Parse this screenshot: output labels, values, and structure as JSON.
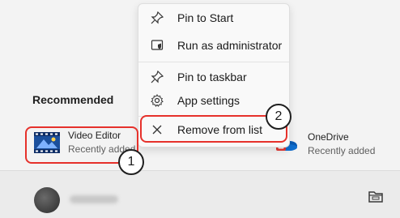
{
  "recommended": {
    "heading": "Recommended",
    "items": [
      {
        "name": "Video Editor",
        "sub": "Recently added"
      },
      {
        "name": "OneDrive",
        "sub": "Recently added"
      }
    ]
  },
  "context_menu": {
    "items": [
      {
        "label": "Pin to Start",
        "icon": "pin-icon"
      },
      {
        "label": "Run as administrator",
        "icon": "shield-icon"
      },
      {
        "label": "Pin to taskbar",
        "icon": "pin-icon"
      },
      {
        "label": "App settings",
        "icon": "gear-icon"
      },
      {
        "label": "Remove from list",
        "icon": "close-icon"
      }
    ]
  },
  "annotations": {
    "badge1": "1",
    "badge2": "2",
    "highlight_color": "#e6312b"
  },
  "taskbar": {
    "icon": "file-explorer-icon"
  }
}
